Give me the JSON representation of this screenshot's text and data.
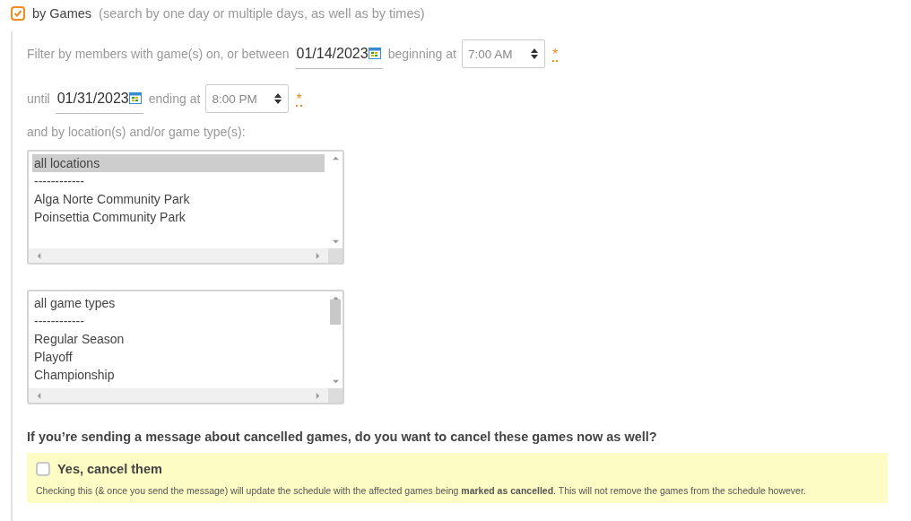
{
  "games_filter": {
    "checked": true,
    "label": "by Games",
    "hint": "(search by one day or multiple days, as well as by times)"
  },
  "row_start": {
    "prefix": "Filter by members with game(s) on, or between",
    "date": "01/14/2023",
    "time_label": "beginning at",
    "time": "7:00 AM",
    "required": "*"
  },
  "row_end": {
    "prefix": "until",
    "date": "01/31/2023",
    "time_label": "ending at",
    "time": "8:00 PM",
    "required": "*"
  },
  "lists_label": "and by location(s) and/or game type(s):",
  "location_list": {
    "items": [
      {
        "label": "all locations",
        "selected": true
      },
      {
        "label": "------------",
        "selected": false
      },
      {
        "label": "Alga Norte Community Park",
        "selected": false
      },
      {
        "label": "Poinsettia Community Park",
        "selected": false
      }
    ]
  },
  "game_type_list": {
    "items": [
      {
        "label": "all game types",
        "selected": false
      },
      {
        "label": "------------",
        "selected": false
      },
      {
        "label": "Regular Season",
        "selected": false
      },
      {
        "label": "Playoff",
        "selected": false
      },
      {
        "label": "Championship",
        "selected": false
      }
    ]
  },
  "cancel_question": "If you’re sending a message about cancelled games, do you want to cancel these games now as well?",
  "cancel_box": {
    "checked": false,
    "label": "Yes, cancel them",
    "note": "Checking this (& once you send the message) will update the schedule with the affected games being **marked as cancelled**. This will not remove the games from the schedule however."
  }
}
